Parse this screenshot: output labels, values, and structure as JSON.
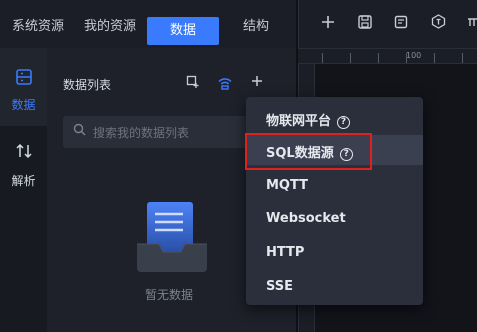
{
  "topnav": {
    "tabs": [
      {
        "label": "系统资源"
      },
      {
        "label": "我的资源"
      },
      {
        "label": "数据"
      },
      {
        "label": "结构"
      }
    ]
  },
  "toolbar": {
    "icons": [
      "plus-icon",
      "save-icon",
      "note-icon",
      "shape-icon",
      "more-icon"
    ],
    "ruler_label": "100"
  },
  "sidebar": {
    "items": [
      {
        "label": "数据",
        "icon": "database-icon",
        "active": true
      },
      {
        "label": "解析",
        "icon": "sort-arrows-icon",
        "active": false
      }
    ]
  },
  "panel": {
    "title": "数据列表",
    "search_placeholder": "搜索我的数据列表",
    "empty_text": "暂无数据"
  },
  "menu": {
    "items": [
      {
        "label": "物联网平台",
        "help": true
      },
      {
        "label": "SQL数据源",
        "help": true
      },
      {
        "label": "MQTT",
        "help": false
      },
      {
        "label": "Websocket",
        "help": false
      },
      {
        "label": "HTTP",
        "help": false
      },
      {
        "label": "SSE",
        "help": false
      }
    ]
  },
  "colors": {
    "accent": "#3a7bfd",
    "highlight_box": "#e0201c"
  }
}
